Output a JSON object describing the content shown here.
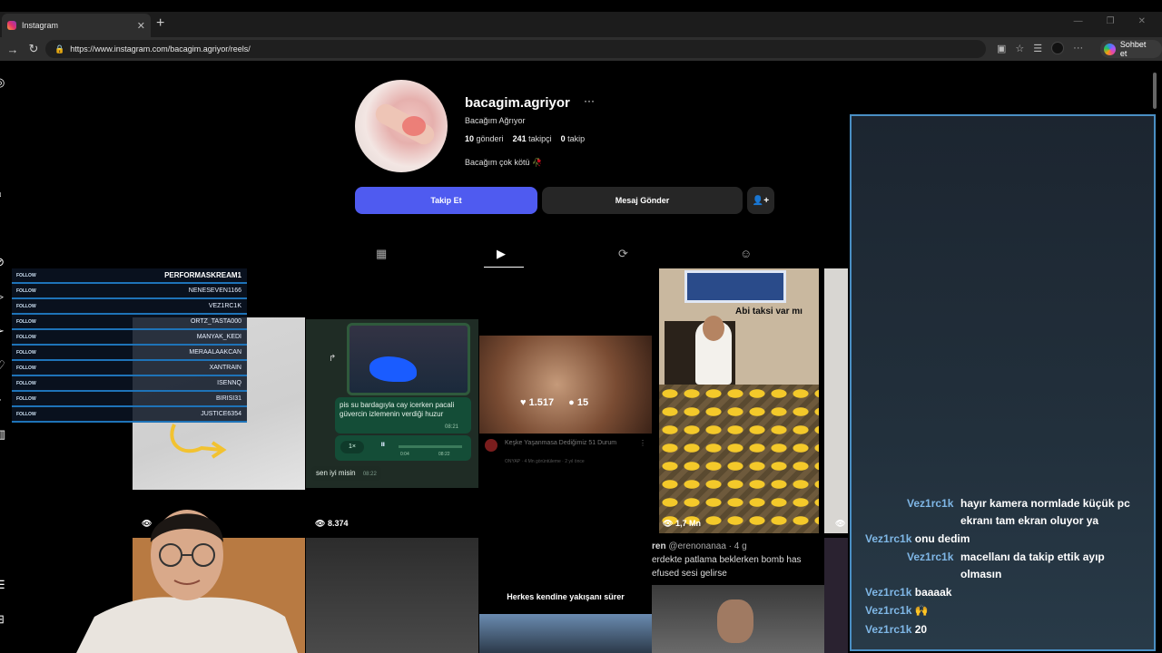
{
  "browser": {
    "tab_title": "Instagram",
    "url": "https://www.instagram.com/bacagim.agriyor/reels/",
    "copilot_label": "Sohbet et"
  },
  "profile": {
    "username": "bacagim.agriyor",
    "full_name": "Bacağım Ağrıyor",
    "posts_count": "10",
    "posts_label": "gönderi",
    "followers_count": "241",
    "followers_label": "takipçi",
    "following_count": "0",
    "following_label": "takip",
    "bio": "Bacağım çok kötü 🥀",
    "follow_label": "Takip Et",
    "message_label": "Mesaj Gönder"
  },
  "overlay": {
    "follow_tag": "FOLLOW",
    "names": [
      "PERFORMASKREAM1",
      "NENESEVEN1166",
      "VEZ1RC1K",
      "ORTZ_TASTA000",
      "MANYAK_KEDI",
      "MERAALAAKCAN",
      "XANTRAIN",
      "ISENNQ",
      "BIRISI31",
      "JUSTICE6354"
    ]
  },
  "reels": {
    "r2_msg1": "pis su bardagıyla cay icerken pacali güvercin izlemenin verdiği huzur",
    "r2_time1": "08:21",
    "r2_speed": "1×",
    "r2_dur": "0:04",
    "r2_time2": "08:22",
    "r2_msg2": "sen iyi misin",
    "r2_time3": "08:22",
    "r2_views": "8.374",
    "r3_likes": "1.517",
    "r3_comments": "15",
    "r3_title": "Keşke Yaşanmasa Dediğimiz 51 Durum",
    "r3_channel": "ONYAP · 4 Mn görüntüleme · 2 yıl önce",
    "r4_caption": "Abi taksi var mı",
    "r4_views": "1,7 Mn",
    "r7_caption": "Herkes kendine yakışanı sürer",
    "r8_user": "ren",
    "r8_handle": "@erenonanaa · 4 g",
    "r8_text1": "erdekte patlama beklerken bomb has",
    "r8_text2": "efused sesi gelirse"
  },
  "chat": {
    "messages": [
      {
        "user": "Vez1rc1k",
        "text": "hayır kamera normlade küçük pc ekranı tam ekran oluyor ya"
      },
      {
        "user": "Vez1rc1k",
        "text": "onu dedim"
      },
      {
        "user": "Vez1rc1k",
        "text": "macellanı da takip ettik ayıp olmasın"
      },
      {
        "user": "Vez1rc1k",
        "text": "baaaak"
      },
      {
        "user": "Vez1rc1k",
        "text": "🙌"
      },
      {
        "user": "Vez1rc1k",
        "text": "20"
      }
    ]
  },
  "colors": {
    "follow_button": "#4f5bf0",
    "chat_border": "#4a8fc4",
    "chat_username": "#7fb7e6"
  }
}
